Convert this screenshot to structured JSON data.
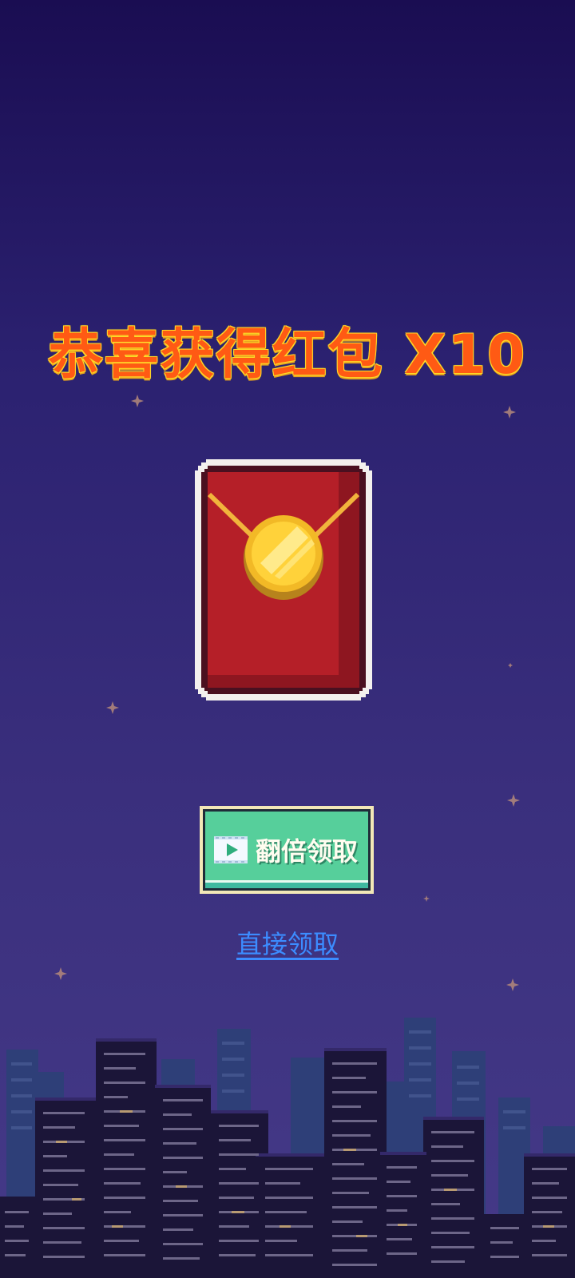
{
  "reward": {
    "title": "恭喜获得红包 X10"
  },
  "actions": {
    "double_claim_label": "翻倍领取",
    "double_claim_icon": "video-play-icon",
    "direct_claim_label": "直接领取"
  },
  "colors": {
    "title_fill": "#ff5a14",
    "title_outline": "#ffd61e",
    "button_fill": "#56cf9b",
    "link": "#3c8cff",
    "sky_top": "#1a0d52",
    "sky_bottom": "#453a88"
  }
}
